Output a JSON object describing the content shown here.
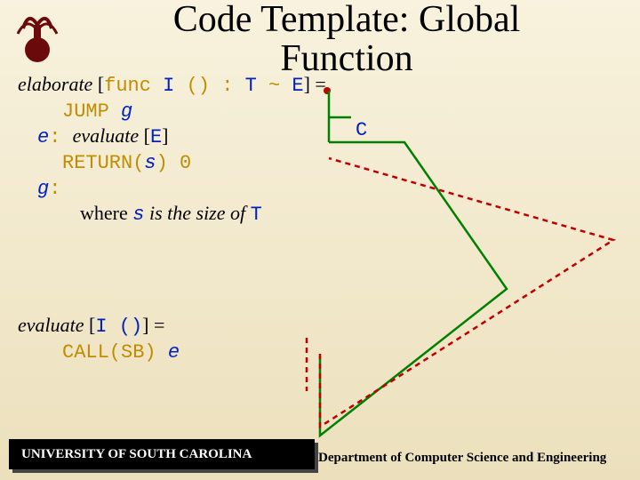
{
  "title_line1": "Code Template: Global",
  "title_line2": "Function",
  "elaborate_word": "elaborate",
  "elaborate_open": " [",
  "kw_func": "func  ",
  "tok_I": "I ",
  "tok_parens": "() ",
  "tok_colon": ": ",
  "tok_T": "T ",
  "tok_tilde": "~ ",
  "tok_E": "E",
  "elaborate_close": "] =",
  "jump_word": "JUMP ",
  "jump_g": "g",
  "e_label": "e",
  "e_colon": ": ",
  "evaluate_word": "evaluate",
  "eval_open": " [",
  "tok_E2": "E",
  "eval_close": "]",
  "return_text": "RETURN(",
  "return_s": "s",
  "return_tail": ") 0",
  "g_label": "g",
  "g_colon": ":",
  "where_pre": "where ",
  "where_s": "s",
  "where_mid": " is the size of ",
  "where_T": "T",
  "evaluate2_word": "evaluate",
  "eval2_open": " [",
  "tok_I2": "I ()",
  "eval2_close": "] =",
  "call_text": "CALL(SB) ",
  "call_e": "e",
  "c_label": "C",
  "footer_left": "UNIVERSITY OF SOUTH CAROLINA",
  "footer_right": "Department of Computer Science and Engineering"
}
